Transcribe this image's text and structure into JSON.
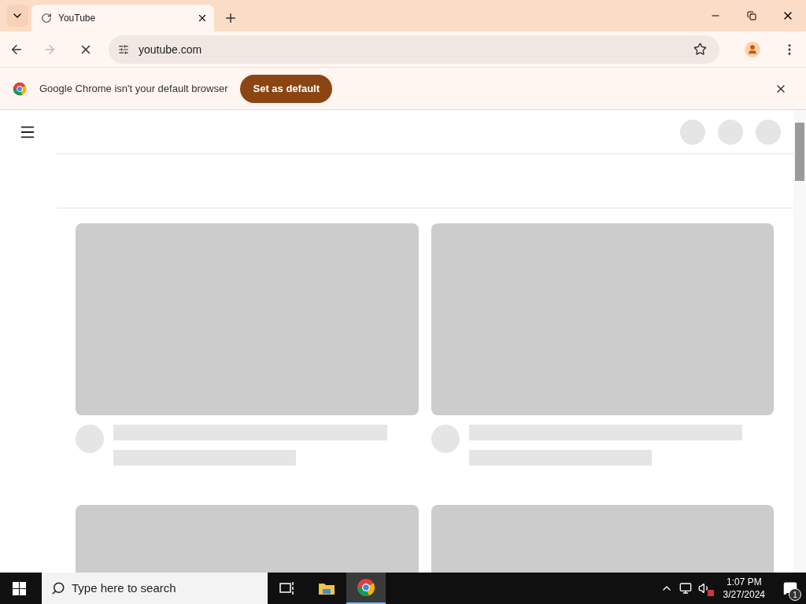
{
  "browser": {
    "tabs": [
      {
        "title": "YouTube",
        "selected": true
      }
    ],
    "back_disabled": false,
    "forward_disabled": true,
    "loading": true,
    "address": "youtube.com"
  },
  "infobar": {
    "message": "Google Chrome isn't your default browser",
    "button": "Set as default"
  },
  "page": {
    "loading": true
  },
  "taskbar": {
    "search_placeholder": "Type here to search",
    "apps": [
      {
        "kind": "taskview",
        "selected": false
      },
      {
        "kind": "explorer",
        "selected": false
      },
      {
        "kind": "chrome",
        "selected": true
      }
    ],
    "time": "1:07 PM",
    "date": "3/27/2024",
    "notifications": "1"
  }
}
